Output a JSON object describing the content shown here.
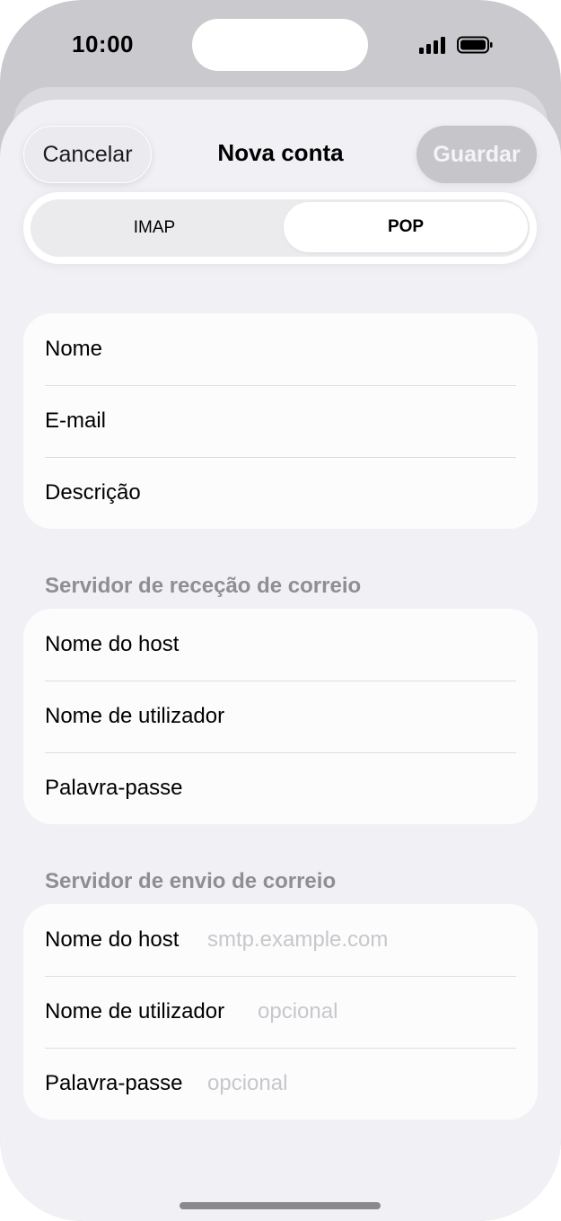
{
  "status": {
    "time": "10:00"
  },
  "nav": {
    "cancel": "Cancelar",
    "title": "Nova conta",
    "save": "Guardar"
  },
  "segment": {
    "imap": "IMAP",
    "pop": "POP",
    "selected": "POP"
  },
  "account": {
    "rows": [
      {
        "label": "Nome",
        "placeholder": ""
      },
      {
        "label": "E-mail",
        "placeholder": ""
      },
      {
        "label": "Descrição",
        "placeholder": ""
      }
    ]
  },
  "incoming": {
    "header": "Servidor de receção de correio",
    "rows": [
      {
        "label": "Nome do host",
        "placeholder": ""
      },
      {
        "label": "Nome de utilizador",
        "placeholder": ""
      },
      {
        "label": "Palavra-passe",
        "placeholder": ""
      }
    ]
  },
  "outgoing": {
    "header": "Servidor de envio de correio",
    "rows": [
      {
        "label": "Nome do host",
        "placeholder": "smtp.example.com"
      },
      {
        "label": "Nome de utilizador",
        "placeholder": "opcional"
      },
      {
        "label": "Palavra-passe",
        "placeholder": "opcional"
      }
    ]
  },
  "colors": {
    "background": "#f1f0f5",
    "card": "#fcfcfd",
    "header_text": "#8e8e93",
    "placeholder": "#c7c7cc"
  }
}
